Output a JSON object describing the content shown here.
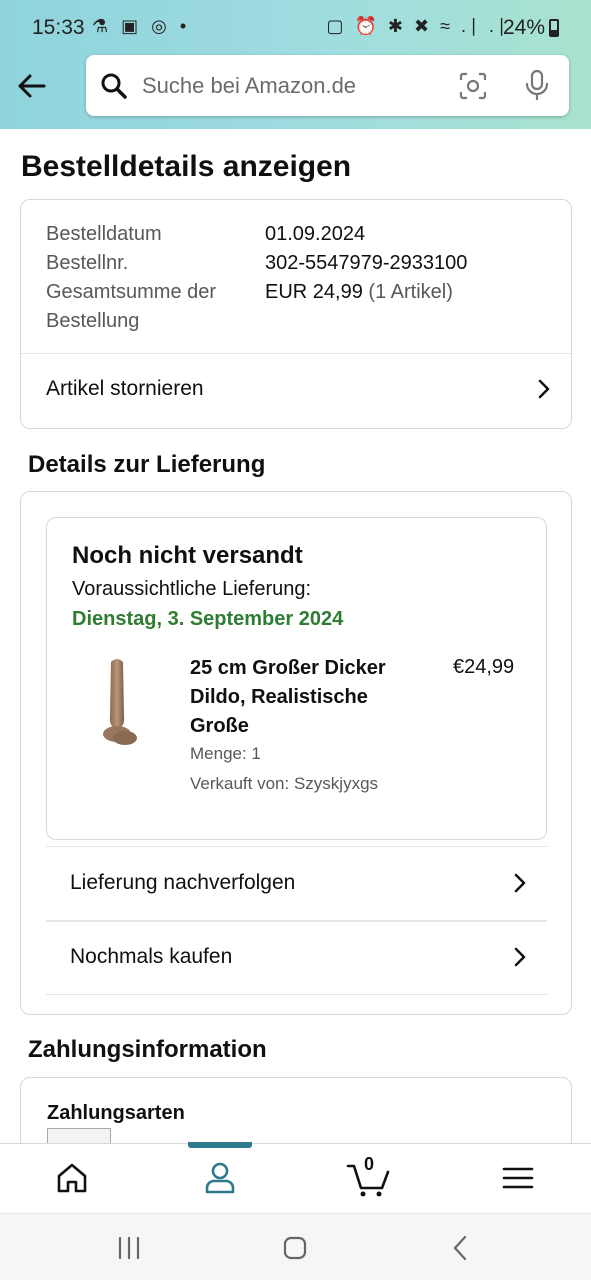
{
  "status_bar": {
    "time": "15:33",
    "left_icons": "⚗ ▣ ◎ •",
    "right_icons": "▢ ⏰ ✱ ✖ ≈ .∣ .∣",
    "battery": "24%"
  },
  "search": {
    "placeholder": "Suche bei Amazon.de"
  },
  "page_title": "Bestelldetails anzeigen",
  "summary": {
    "rows": [
      {
        "label": "Bestelldatum",
        "value": "01.09.2024"
      },
      {
        "label": "Bestellnr.",
        "value": "302-5547979-2933100"
      },
      {
        "label": "Gesamtsumme der Bestellung",
        "value": "EUR 24,99",
        "extra": "(1 Artikel)"
      }
    ],
    "label_line1": "Gesamtsumme der",
    "label_line2": "Bestellung",
    "cancel_link": "Artikel stornieren"
  },
  "delivery": {
    "heading": "Details zur Lieferung",
    "status": "Noch nicht versandt",
    "eta_label": "Voraussichtliche Lieferung:",
    "eta_date": "Dienstag, 3. September 2024",
    "item": {
      "name_line1": "25 cm Großer Dicker",
      "name_line2": "Dildo, Realistische",
      "name_line3": "Große",
      "price": "€24,99",
      "quantity": "Menge: 1",
      "seller": "Verkauft von: Szyskjyxgs"
    },
    "track_link": "Lieferung nachverfolgen",
    "buy_again_link": "Nochmals kaufen"
  },
  "payment": {
    "heading": "Zahlungsinformation",
    "methods_title": "Zahlungsarten"
  },
  "bottom_nav": {
    "cart_count": "0",
    "active": "account"
  },
  "colors": {
    "header_gradient_start": "#8fd3dc",
    "header_gradient_end": "#a8e2cf",
    "delivery_green": "#2e7d32",
    "active_nav": "#2c7a8c"
  }
}
